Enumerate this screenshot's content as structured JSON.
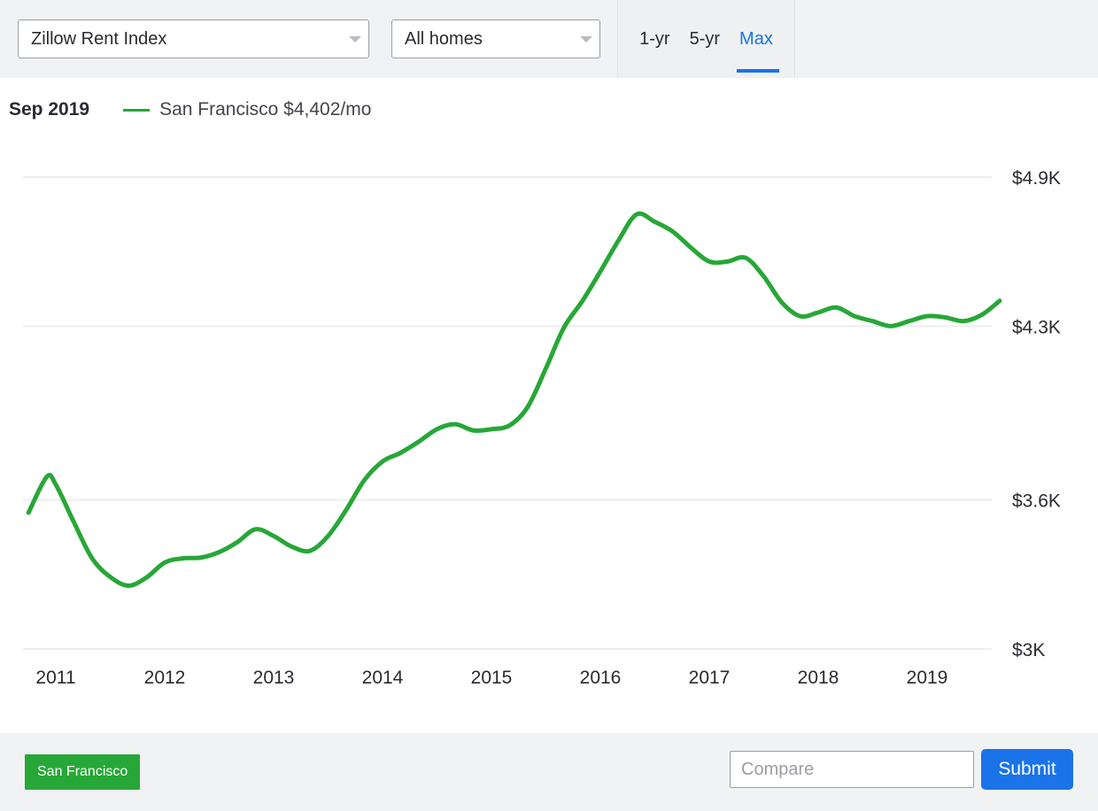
{
  "toolbar": {
    "metric_select": {
      "value": "Zillow Rent Index",
      "caret": "chevron-down-icon"
    },
    "hometype_select": {
      "value": "All homes",
      "caret": "chevron-down-icon"
    },
    "range_tabs": [
      {
        "label": "1-yr",
        "active": false
      },
      {
        "label": "5-yr",
        "active": false
      },
      {
        "label": "Max",
        "active": true
      }
    ]
  },
  "legend": {
    "date": "Sep 2019",
    "series_label": "San Francisco $4,402/mo",
    "series_color": "#27a737"
  },
  "footer": {
    "chip_label": "San Francisco",
    "chip_color": "#27a737",
    "compare_placeholder": "Compare",
    "compare_value": "",
    "submit_label": "Submit",
    "submit_color": "#1a73e8"
  },
  "chart_data": {
    "type": "line",
    "title": "",
    "xlabel": "",
    "ylabel": "",
    "grid": true,
    "legend_position": "top-left",
    "ylim": [
      3000,
      4900
    ],
    "ytick_values": [
      4900,
      4300,
      3600,
      3000
    ],
    "ytick_labels": [
      "$4.9K",
      "$4.3K",
      "$3.6K",
      "$3K"
    ],
    "xlim": [
      "2010-10",
      "2019-09"
    ],
    "xtick_labels": [
      "2011",
      "2012",
      "2013",
      "2014",
      "2015",
      "2016",
      "2017",
      "2018",
      "2019"
    ],
    "series": [
      {
        "name": "San Francisco",
        "color": "#27a737",
        "unit": "$/mo",
        "last_value": 4402,
        "last_date": "Sep 2019",
        "x": [
          "2010-10",
          "2010-12",
          "2011-01",
          "2011-03",
          "2011-05",
          "2011-07",
          "2011-09",
          "2011-11",
          "2012-01",
          "2012-03",
          "2012-05",
          "2012-07",
          "2012-09",
          "2012-11",
          "2013-01",
          "2013-03",
          "2013-05",
          "2013-07",
          "2013-09",
          "2013-11",
          "2014-01",
          "2014-03",
          "2014-05",
          "2014-07",
          "2014-09",
          "2014-11",
          "2015-01",
          "2015-03",
          "2015-05",
          "2015-07",
          "2015-09",
          "2015-11",
          "2016-01",
          "2016-03",
          "2016-05",
          "2016-07",
          "2016-09",
          "2016-11",
          "2017-01",
          "2017-03",
          "2017-05",
          "2017-07",
          "2017-09",
          "2017-11",
          "2018-01",
          "2018-03",
          "2018-05",
          "2018-07",
          "2018-09",
          "2018-11",
          "2019-01",
          "2019-03",
          "2019-05",
          "2019-07",
          "2019-09"
        ],
        "values": [
          3549,
          3693,
          3662,
          3510,
          3365,
          3290,
          3255,
          3288,
          3348,
          3365,
          3368,
          3390,
          3430,
          3482,
          3455,
          3412,
          3395,
          3455,
          3560,
          3680,
          3755,
          3790,
          3835,
          3885,
          3905,
          3880,
          3885,
          3900,
          3975,
          4130,
          4295,
          4400,
          4520,
          4645,
          4750,
          4720,
          4680,
          4615,
          4560,
          4560,
          4575,
          4500,
          4395,
          4340,
          4355,
          4375,
          4340,
          4320,
          4300,
          4320,
          4340,
          4335,
          4320,
          4345,
          4402
        ]
      }
    ]
  }
}
